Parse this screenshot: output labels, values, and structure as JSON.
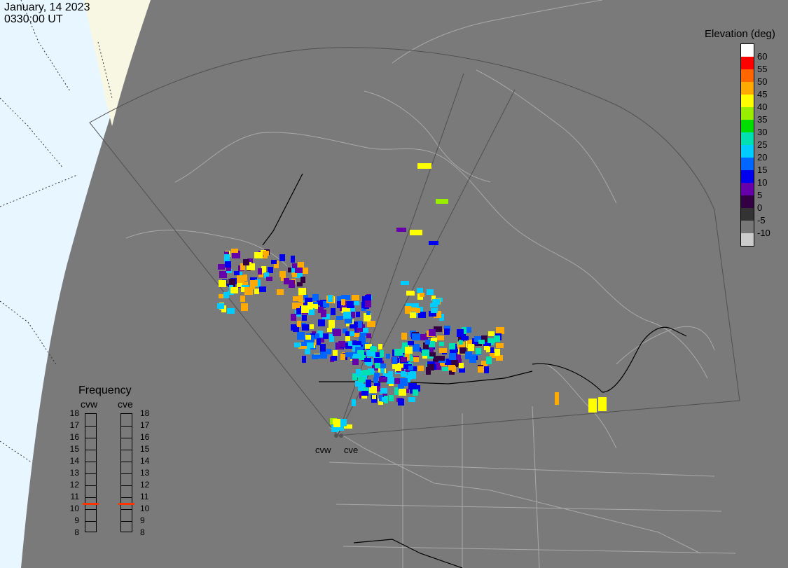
{
  "header": {
    "date": "January, 14 2023",
    "time": "0330:00 UT"
  },
  "elevation_legend": {
    "title": "Elevation (deg)",
    "levels": [
      {
        "label": "60",
        "color": "#ffffff"
      },
      {
        "label": "55",
        "color": "#ff0000"
      },
      {
        "label": "50",
        "color": "#ff6600"
      },
      {
        "label": "45",
        "color": "#ffaa00"
      },
      {
        "label": "40",
        "color": "#ffff00"
      },
      {
        "label": "35",
        "color": "#99ee00"
      },
      {
        "label": "30",
        "color": "#00dd00"
      },
      {
        "label": "25",
        "color": "#00e0b0"
      },
      {
        "label": "20",
        "color": "#00ccff"
      },
      {
        "label": "15",
        "color": "#0066ff"
      },
      {
        "label": "10",
        "color": "#0000ee"
      },
      {
        "label": "5",
        "color": "#6600aa"
      },
      {
        "label": "0",
        "color": "#330044"
      },
      {
        "label": "-5",
        "color": "#333333"
      },
      {
        "label": "-10",
        "color": "#777777"
      },
      {
        "label": "",
        "color": "#cccccc"
      }
    ]
  },
  "frequency_panel": {
    "title": "Frequency",
    "radar_left": "cvw",
    "radar_right": "cve",
    "ticks": [
      "18",
      "17",
      "16",
      "15",
      "14",
      "13",
      "12",
      "11",
      "10",
      "9",
      "8"
    ],
    "cvw_mhz": 11,
    "cve_mhz": 11,
    "marker_color": "#ff3300"
  },
  "radar_labels": {
    "west": "cvw",
    "east": "cve"
  },
  "colors": {
    "background": "#7a7a7a",
    "daylight": "#e8f6ff",
    "terminator_band": "#f8f8e8",
    "coastline": "#a9a9a9",
    "fov": "#505050"
  }
}
